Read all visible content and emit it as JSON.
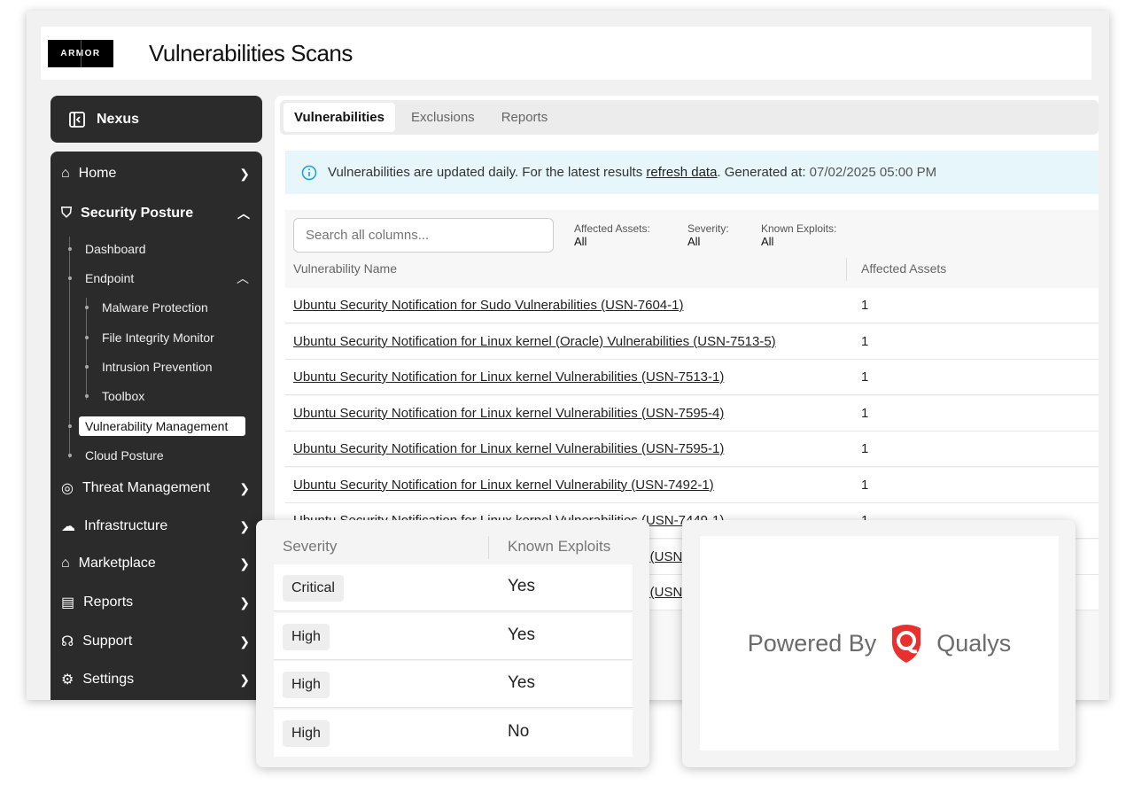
{
  "header": {
    "logo": "ARMOR",
    "title": "Vulnerabilities Scans"
  },
  "sidebar": {
    "nexus": "Nexus",
    "items": [
      {
        "label": "Home",
        "icon": "home-icon"
      },
      {
        "label": "Security Posture",
        "icon": "shield-icon"
      },
      {
        "label": "Threat Management",
        "icon": "target-icon"
      },
      {
        "label": "Infrastructure",
        "icon": "cloud-icon"
      },
      {
        "label": "Marketplace",
        "icon": "store-icon"
      },
      {
        "label": "Reports",
        "icon": "clipboard-icon"
      },
      {
        "label": "Support",
        "icon": "headset-icon"
      },
      {
        "label": "Settings",
        "icon": "gear-icon"
      }
    ],
    "sub": [
      "Dashboard",
      "Endpoint",
      "Malware Protection",
      "File Integrity Monitor",
      "Intrusion Prevention",
      "Toolbox",
      "Vulnerability Management",
      "Cloud Posture"
    ]
  },
  "tabs": [
    "Vulnerabilities",
    "Exclusions",
    "Reports"
  ],
  "info": {
    "text": "Vulnerabilities are updated daily. For the latest results",
    "link": "refresh data",
    "gen": ". Generated at:",
    "date": "07/02/2025 05:00 PM"
  },
  "search": {
    "placeholder": "Search all columns..."
  },
  "filters": [
    {
      "label": "Affected Assets:",
      "value": "All"
    },
    {
      "label": "Severity:",
      "value": "All"
    },
    {
      "label": "Known Exploits:",
      "value": "All"
    }
  ],
  "table": {
    "headers": [
      "Vulnerability Name",
      "Affected Assets"
    ],
    "rows": [
      {
        "name": "Ubuntu Security Notification for Sudo Vulnerabilities (USN-7604-1)",
        "assets": "1"
      },
      {
        "name": "Ubuntu Security Notification for Linux kernel (Oracle) Vulnerabilities (USN-7513-5)",
        "assets": "1"
      },
      {
        "name": "Ubuntu Security Notification for Linux kernel Vulnerabilities (USN-7513-1)",
        "assets": "1"
      },
      {
        "name": "Ubuntu Security Notification for Linux kernel Vulnerabilities (USN-7595-4)",
        "assets": "1"
      },
      {
        "name": "Ubuntu Security Notification for Linux kernel Vulnerabilities (USN-7595-1)",
        "assets": "1"
      },
      {
        "name": "Ubuntu Security Notification for Linux kernel Vulnerability (USN-7492-1)",
        "assets": "1"
      },
      {
        "name": "Ubuntu Security Notification for Linux kernel Vulnerabilities (USN-7449-1)",
        "assets": "1"
      },
      {
        "name": "s (USN",
        "assets": ""
      },
      {
        "name": "s (USN",
        "assets": ""
      }
    ]
  },
  "popover": {
    "headers": [
      "Severity",
      "Known Exploits"
    ],
    "rows": [
      {
        "severity": "Critical",
        "exploits": "Yes"
      },
      {
        "severity": "High",
        "exploits": "Yes"
      },
      {
        "severity": "High",
        "exploits": "Yes"
      },
      {
        "severity": "High",
        "exploits": "No"
      }
    ]
  },
  "powered": {
    "text": "Powered By",
    "brand": "Qualys",
    "brand_color": "#e8312f"
  }
}
